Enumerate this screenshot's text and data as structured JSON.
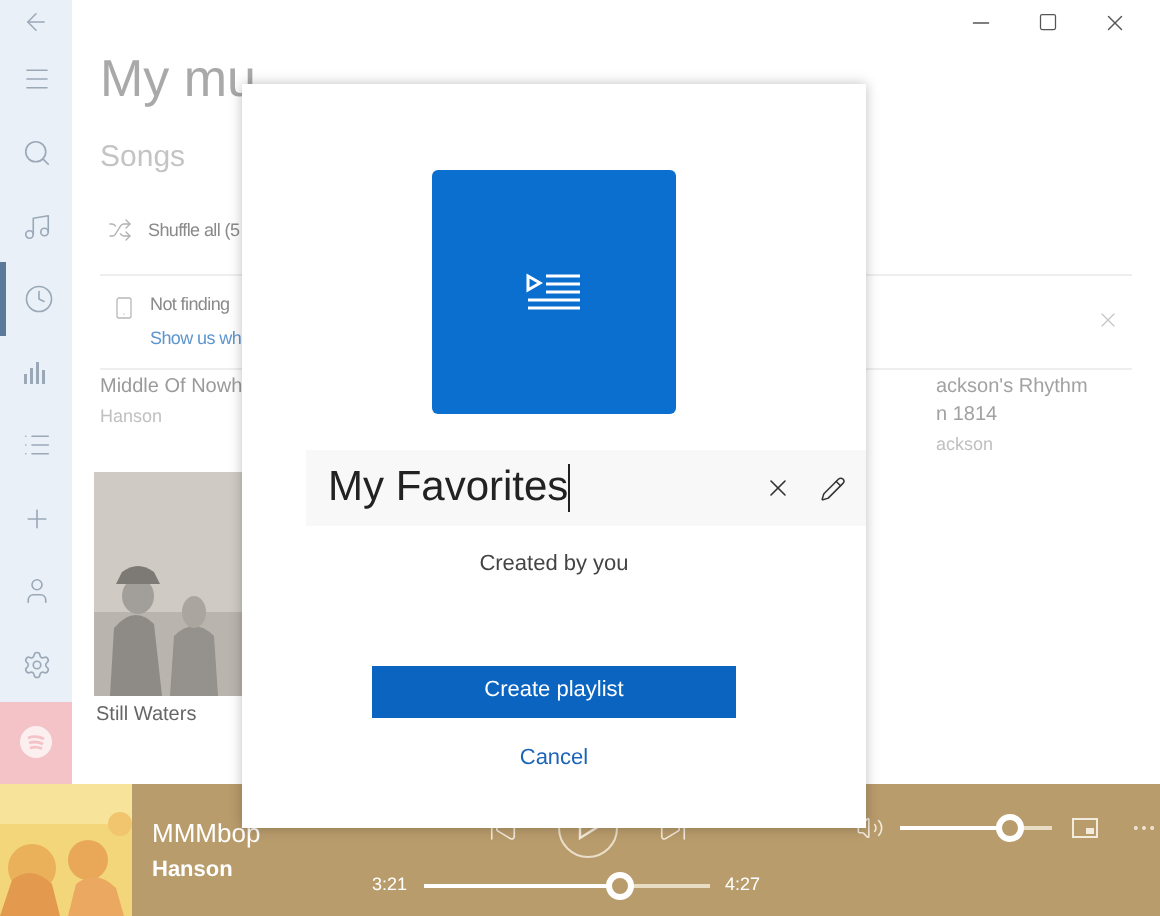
{
  "sidebar": {
    "items": [
      {
        "kind": "menu",
        "selected": false
      },
      {
        "kind": "search",
        "selected": false
      },
      {
        "kind": "music",
        "selected": false
      },
      {
        "kind": "recent",
        "selected": true
      },
      {
        "kind": "charts",
        "selected": false
      },
      {
        "kind": "list",
        "selected": false
      },
      {
        "kind": "add",
        "selected": false
      },
      {
        "kind": "account",
        "selected": false
      },
      {
        "kind": "settings",
        "selected": false
      }
    ]
  },
  "page": {
    "title": "My mu",
    "subtitle": "Songs",
    "shuffle": "Shuffle all (5",
    "notice": {
      "text": "Not finding",
      "link": "Show us wh"
    },
    "songs": [
      {
        "title": "Middle Of Nowh",
        "artist": "Hanson"
      },
      {
        "title": "ackson's Rhythm",
        "title_line_2": "n 1814",
        "artist": "ackson"
      }
    ],
    "album": {
      "title": "Still Waters"
    }
  },
  "dialog": {
    "name": "My Favorites",
    "owner": "Created by you",
    "primary": "Create playlist",
    "cancel": "Cancel"
  },
  "player": {
    "title": "MMMbop",
    "artist": "Hanson",
    "elapsed": "3:21",
    "total": "4:27",
    "seek": {
      "level": 0.69
    },
    "volume": {
      "level": 0.72
    }
  }
}
